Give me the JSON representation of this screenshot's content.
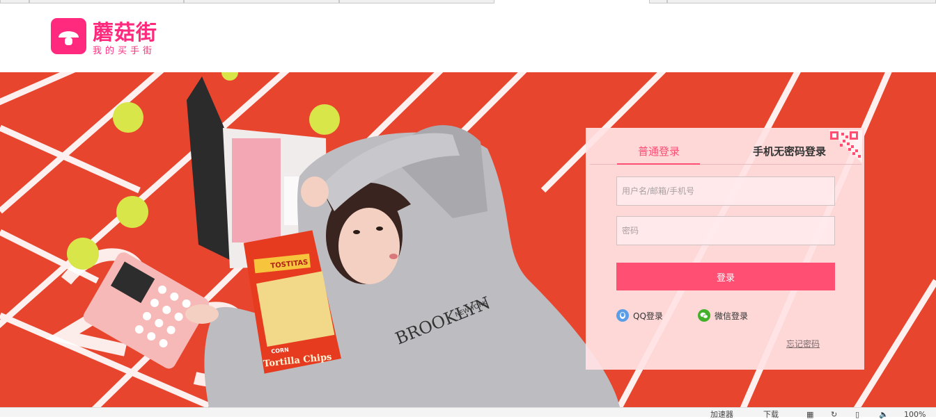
{
  "brand": {
    "name": "蘑菇街",
    "slogan": "我的买手街",
    "color": "#ff2a7e"
  },
  "login": {
    "tabs": [
      {
        "label": "普通登录",
        "active": true
      },
      {
        "label": "手机无密码登录",
        "active": false
      }
    ],
    "username_placeholder": "用户名/邮箱/手机号",
    "password_placeholder": "密码",
    "submit_label": "登录",
    "social": [
      {
        "label": "QQ登录",
        "icon": "qq-icon"
      },
      {
        "label": "微信登录",
        "icon": "wechat-icon"
      }
    ],
    "forgot_label": "忘记密码",
    "accent": "#ff4f72"
  },
  "banner": {
    "calculator_brand": "",
    "chips_label": "Tortilla Chips",
    "chips_brand": "CORN",
    "hoodie_text": "BROOKLYN",
    "hoodie_sub": "NEW YORK"
  },
  "statusbar": {
    "items": [
      "加速器",
      "下载",
      "100%"
    ]
  }
}
